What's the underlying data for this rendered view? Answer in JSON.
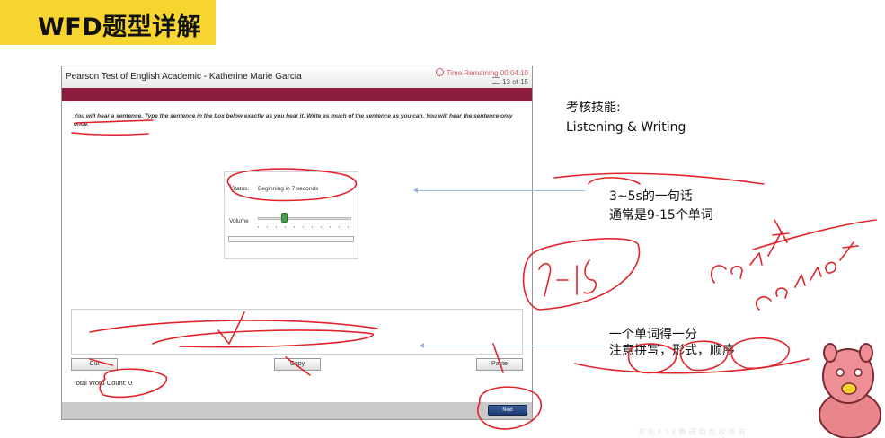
{
  "slide": {
    "title": "WFD题型详解"
  },
  "test_window": {
    "title": "Pearson Test of English Academic - Katherine Marie Garcia",
    "timer_label": "Time Remaining 00:04:10",
    "counter": "13 of 15",
    "instructions": "You will hear a sentence. Type the sentence in the box below exactly as you hear it. Write as much of the sentence as you can. You will hear the sentence only once.",
    "audio": {
      "status_label": "Status:",
      "status_value": "Beginning in 7 seconds",
      "volume_label": "Volume",
      "progress": 0
    },
    "answer_value": "",
    "buttons": {
      "cut": "Cut",
      "copy": "Copy",
      "paste": "Paste",
      "next": "Next"
    },
    "word_count_label": "Total Word Count: 0"
  },
  "notes": {
    "skills_heading": "考核技能:",
    "skills_value": "Listening & Writing",
    "sentence_length": "3~5s的一句话",
    "word_count_hint": "通常是9-15个单词",
    "scoring": "一个单词得一分",
    "attention": "注意拼写，形式，顺序"
  },
  "handwriting": [
    "9-15",
    "Can't",
    "cannot"
  ],
  "watermark": "羊驼PTE教研组版权所有",
  "colors": {
    "accent_yellow": "#f7d531",
    "pte_maroon": "#8d1d3f",
    "ink_red": "#e0242a",
    "arrow_blue": "#9bb4dc",
    "mascot_pink": "#e8868c"
  }
}
